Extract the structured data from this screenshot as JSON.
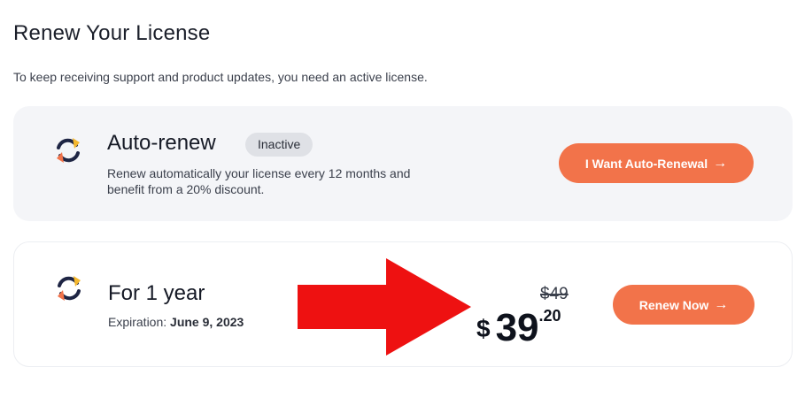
{
  "page": {
    "title": "Renew Your License",
    "subtitle": "To keep receiving support and product updates, you need an active license."
  },
  "auto_renew": {
    "icon": "renew-cycle-icon",
    "title": "Auto-renew",
    "badge": "Inactive",
    "description": "Renew automatically your license every 12 months and benefit from a 20% discount.",
    "button_label": "I Want Auto-Renewal"
  },
  "one_year": {
    "icon": "renew-cycle-icon",
    "title": "For 1 year",
    "expiration_label": "Expiration:",
    "expiration_date": "June 9, 2023",
    "old_price": "$49",
    "currency": "$",
    "price_whole": "39",
    "price_cents": ".20",
    "button_label": "Renew Now"
  },
  "colors": {
    "accent": "#f2734a",
    "card_background": "#f4f5f8",
    "badge_background": "#dfe1e6",
    "annotation_arrow": "#ee1111",
    "icon_orange": "#f2734a",
    "icon_yellow": "#f5b82e",
    "icon_navy": "#1e2544"
  },
  "icons": {
    "button_arrow": "arrow-right-icon",
    "annotation": "red-arrow-annotation"
  }
}
